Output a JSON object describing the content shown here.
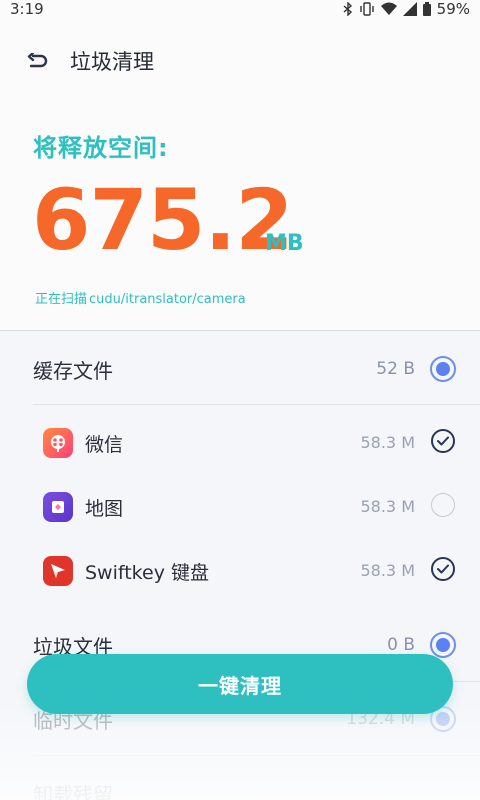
{
  "status_bar": {
    "time": "3:19",
    "battery": "59%"
  },
  "header": {
    "title": "垃圾清理"
  },
  "summary": {
    "release_label": "将释放空间:",
    "size_value": "675.2",
    "size_unit": "MB",
    "scan_prefix": "正在扫描",
    "scan_path": "cudu/itranslator/camera"
  },
  "groups": [
    {
      "title": "缓存文件",
      "size": "52 B",
      "items": [
        {
          "name": "微信",
          "size": "58.3 M",
          "checked": true,
          "icon": "video-app-icon"
        },
        {
          "name": "地图",
          "size": "58.3 M",
          "checked": false,
          "icon": "map-app-icon"
        },
        {
          "name": "Swiftkey 键盘",
          "size": "58.3 M",
          "checked": true,
          "icon": "swiftkey-app-icon"
        }
      ]
    },
    {
      "title": "垃圾文件",
      "size": "0 B"
    },
    {
      "title": "临时文件",
      "size": "132.4 M"
    },
    {
      "title": "卸载残留",
      "size": ""
    }
  ],
  "actions": {
    "clean_label": "一键清理"
  },
  "colors": {
    "accent": "#2ec0c0",
    "orange": "#f5682a",
    "radio": "#5b82ee"
  }
}
